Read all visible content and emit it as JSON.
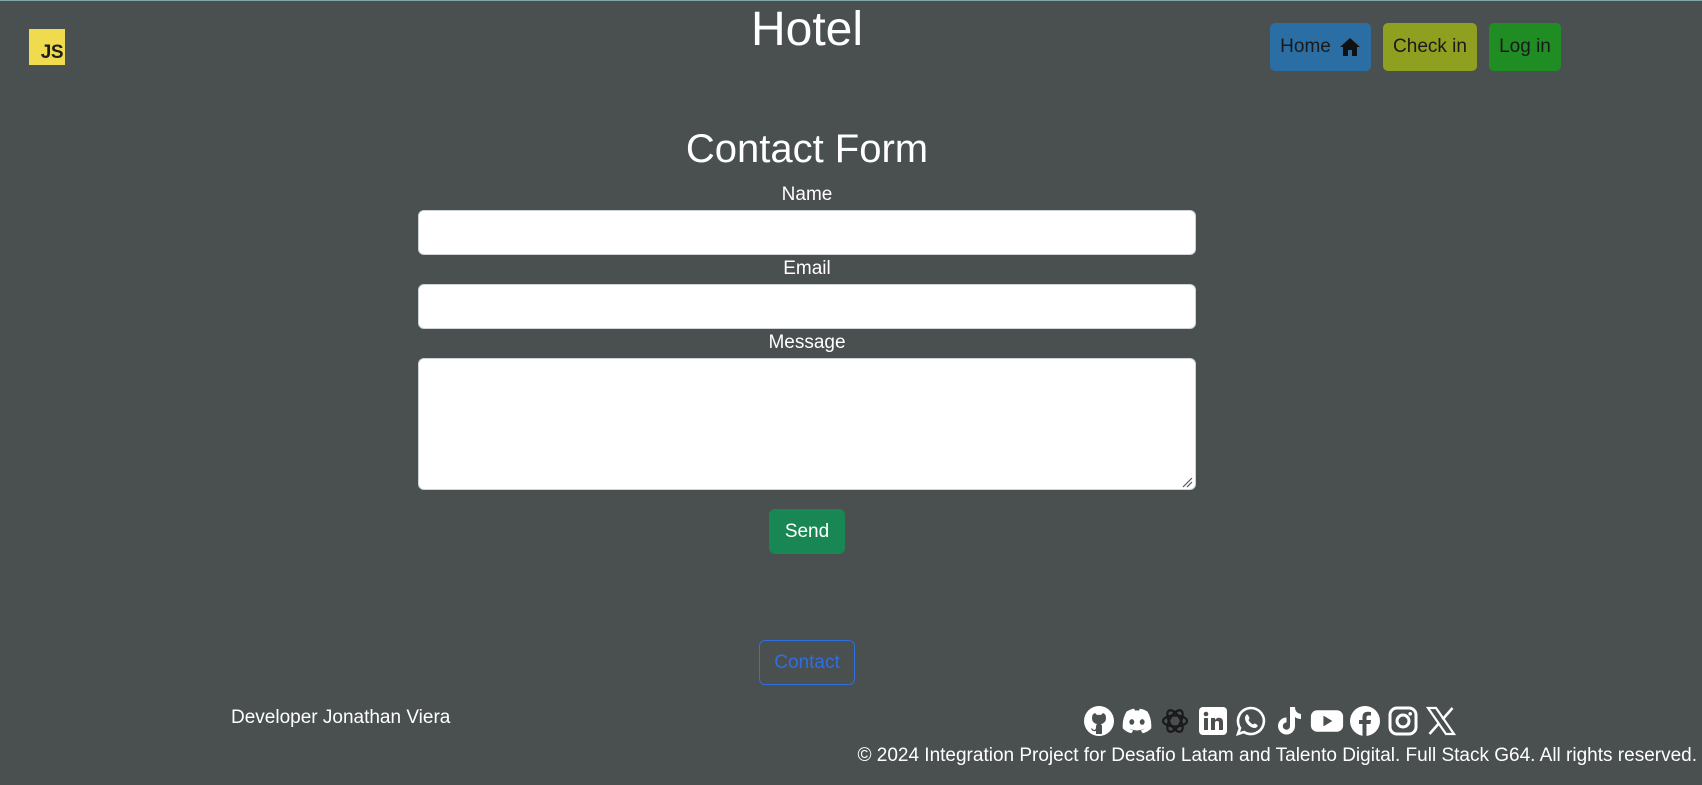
{
  "header": {
    "logo_text": "JS",
    "logo_color": "#f0db4f",
    "title": "Hotel",
    "nav": {
      "home_label": "Home",
      "home_icon": "house-icon",
      "checkin_label": "Check in",
      "login_label": "Log in"
    }
  },
  "form": {
    "title": "Contact Form",
    "name_label": "Name",
    "name_value": "",
    "email_label": "Email",
    "email_value": "",
    "message_label": "Message",
    "message_value": "",
    "send_label": "Send"
  },
  "footer": {
    "contact_label": "Contact",
    "developer": "Developer Jonathan Viera",
    "social_icons": [
      "github-icon",
      "discord-icon",
      "openai-icon",
      "linkedin-icon",
      "whatsapp-icon",
      "tiktok-icon",
      "youtube-icon",
      "facebook-icon",
      "instagram-icon",
      "x-icon"
    ],
    "copyright": "© 2024 Integration Project for Desafio Latam and Talento Digital. Full Stack G64. All rights reserved."
  },
  "colors": {
    "background": "#4a4f50",
    "home_button": "#2a6ea3",
    "checkin_button": "#8f9f1f",
    "login_button": "#1f8d23",
    "send_button": "#198754",
    "contact_link": "#2f6fe0"
  }
}
